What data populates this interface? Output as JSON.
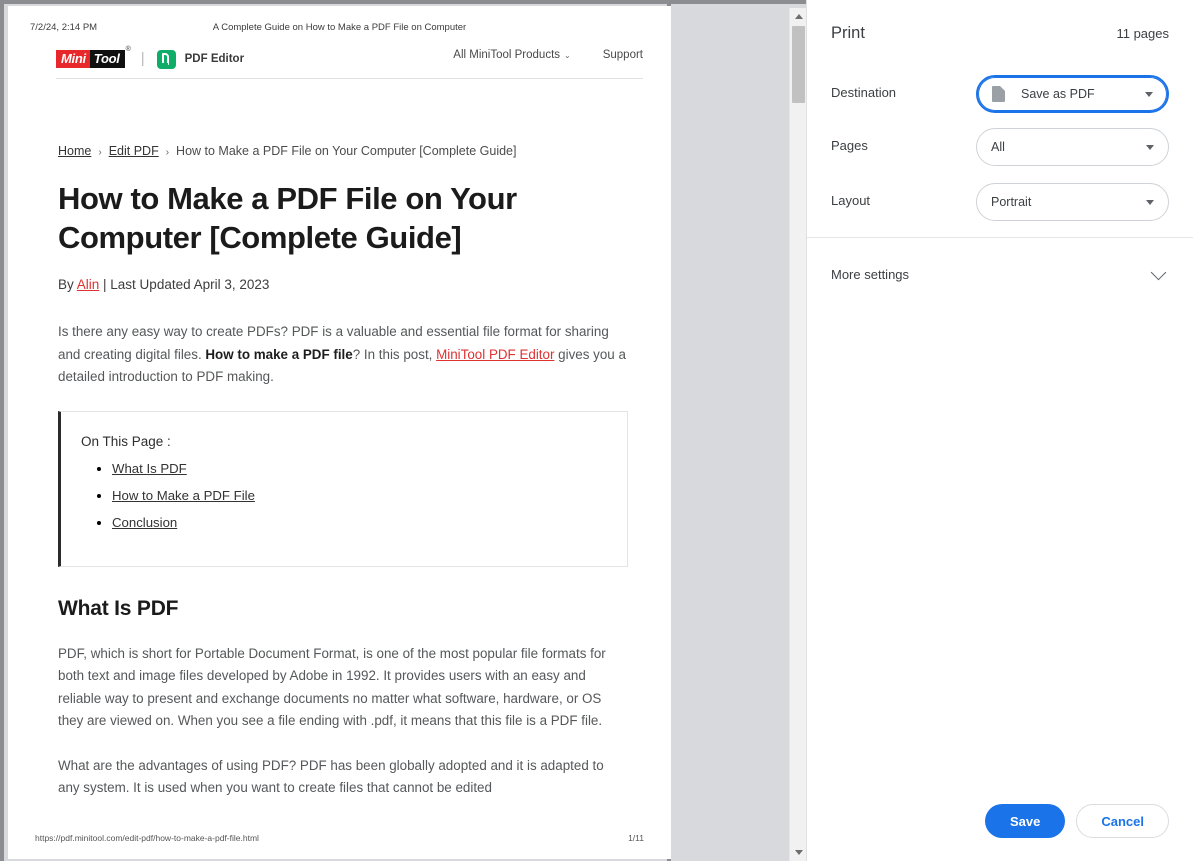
{
  "preview": {
    "meta": {
      "date": "7/2/24, 2:14 PM",
      "doc_title": "A Complete Guide on How to Make a PDF File on Computer"
    },
    "site_header": {
      "logo_mini": "Mini",
      "logo_tool": "Tool",
      "logo_registered": "®",
      "divider": "|",
      "product_label": "PDF Editor",
      "nav": [
        {
          "label": "All MiniTool Products",
          "caret": "⌄"
        },
        {
          "label": "Support",
          "caret": ""
        }
      ]
    },
    "breadcrumb": {
      "items": [
        {
          "label": "Home",
          "link": true
        },
        {
          "label": "Edit PDF",
          "link": true
        },
        {
          "label": "How to Make a PDF File on Your Computer [Complete Guide]",
          "link": false
        }
      ],
      "separator": "›"
    },
    "article": {
      "title": "How to Make a PDF File on Your Computer [Complete Guide]",
      "byline_prefix": "By ",
      "byline_author": "Alin",
      "byline_suffix": " | Last Updated April 3, 2023",
      "intro_part1": "Is there any easy way to create PDFs? PDF is a valuable and essential file format for sharing and creating digital files. ",
      "intro_bold": "How to make a PDF file",
      "intro_part2": "? In this post, ",
      "intro_link": "MiniTool PDF Editor",
      "intro_part3": " gives you a detailed introduction to PDF making.",
      "toc_title": "On This Page :",
      "toc_items": [
        "What Is PDF",
        "How to Make a PDF File",
        "Conclusion"
      ],
      "section_title": "What Is PDF",
      "section_paragraph_1": "PDF, which is short for Portable Document Format, is one of the most popular file formats for both text and image files developed by Adobe in 1992. It provides users with an easy and reliable way to present and exchange documents no matter what software, hardware, or OS they are viewed on. When you see a file ending with .pdf, it means that this file is a PDF file.",
      "section_paragraph_2": "What are the advantages of using PDF? PDF has been globally adopted and it is adapted to any system. It is used when you want to create files that cannot be edited"
    },
    "footer": {
      "url": "https://pdf.minitool.com/edit-pdf/how-to-make-a-pdf-file.html",
      "page_number": "1/11"
    }
  },
  "print_panel": {
    "title": "Print",
    "page_count": "11 pages",
    "settings": [
      {
        "label": "Destination",
        "value": "Save as PDF",
        "icon": "document-icon",
        "focused": true
      },
      {
        "label": "Pages",
        "value": "All",
        "icon": "",
        "focused": false
      },
      {
        "label": "Layout",
        "value": "Portrait",
        "icon": "",
        "focused": false
      }
    ],
    "more_settings_label": "More settings",
    "save_label": "Save",
    "cancel_label": "Cancel",
    "accent_color": "#1a73e8"
  }
}
